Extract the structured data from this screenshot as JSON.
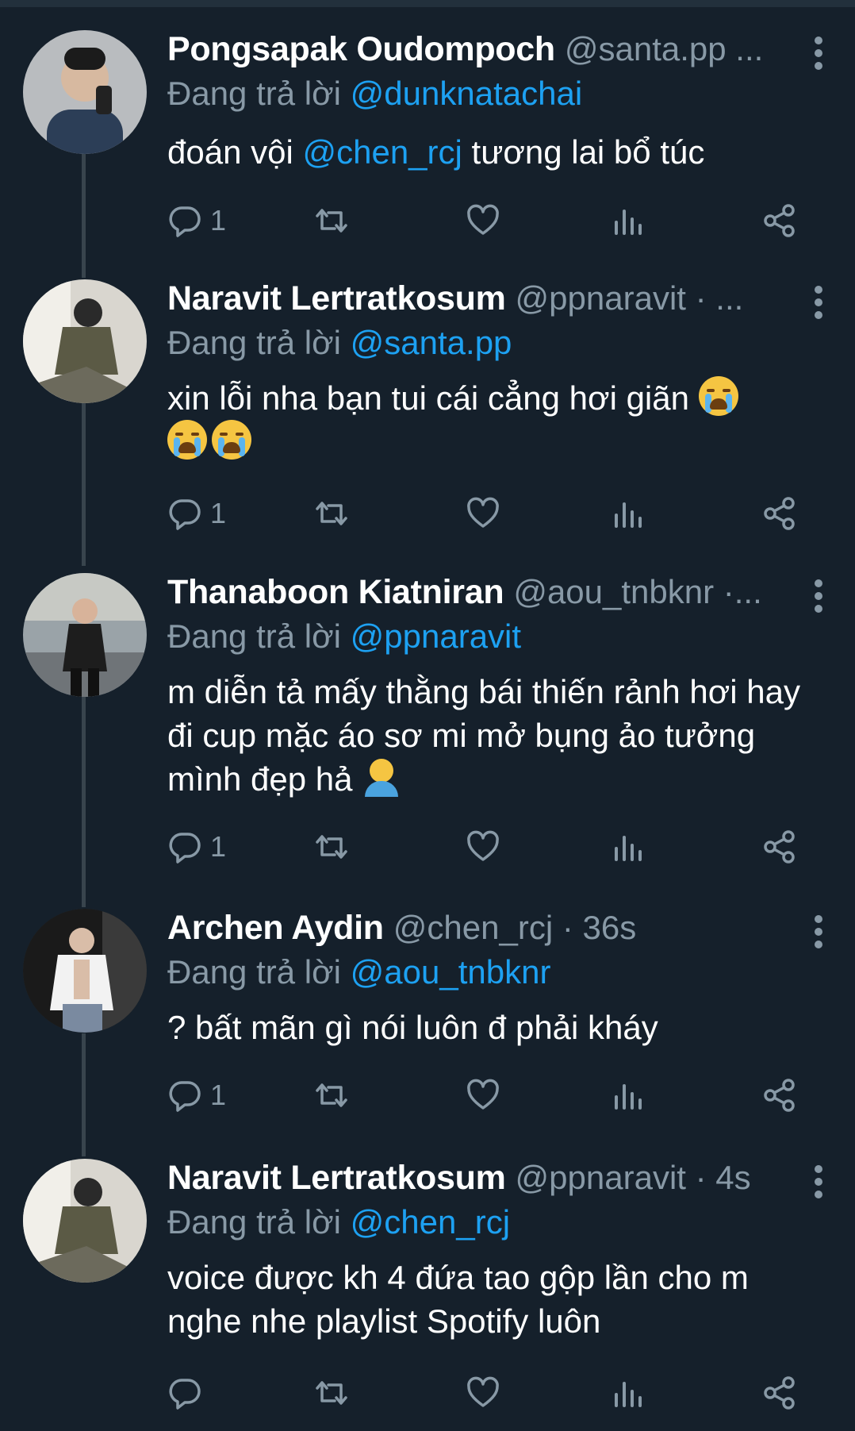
{
  "colors": {
    "background": "#15202b",
    "secondary_text": "#8899a6",
    "accent": "#1da1f2",
    "thread_line": "#38444d"
  },
  "replying_prefix": "Đang trả lời",
  "tweets": [
    {
      "name": "Pongsapak Oudompoch",
      "handle": "@santa.pp ...",
      "replying_to": "@dunknatachai",
      "text_before": "đoán vội ",
      "mention": "@chen_rcj",
      "text_after": " tương lai bổ túc",
      "reply_count": "1"
    },
    {
      "name": "Naravit Lertratkosum",
      "handle": "@ppnaravit · ...",
      "replying_to": "@santa.pp",
      "text": "xin lỗi nha bạn tui cái cẳng hơi giãn",
      "emojis": [
        "loudly-crying-face",
        "loudly-crying-face",
        "loudly-crying-face"
      ],
      "reply_count": "1"
    },
    {
      "name": "Thanaboon Kiatniran",
      "handle": "@aou_tnbknr ·...",
      "replying_to": "@ppnaravit",
      "text": "m diễn tả mấy thằng bái thiến rảnh hơi hay đi cup mặc áo sơ mi mở bụng ảo tưởng mình đẹp hả",
      "emojis": [
        "man-getting-massage"
      ],
      "reply_count": "1"
    },
    {
      "name": "Archen Aydin",
      "handle": "@chen_rcj · 36s",
      "replying_to": "@aou_tnbknr",
      "text": "? bất mãn gì nói luôn đ phải kháy",
      "reply_count": "1"
    },
    {
      "name": "Naravit Lertratkosum",
      "handle": "@ppnaravit · 4s",
      "replying_to": "@chen_rcj",
      "text": "voice được kh 4 đứa tao gộp lần cho m nghe nhe playlist Spotify luôn",
      "reply_count": ""
    }
  ],
  "icons": [
    "reply-icon",
    "retweet-icon",
    "like-icon",
    "analytics-icon",
    "share-icon",
    "more-icon"
  ]
}
